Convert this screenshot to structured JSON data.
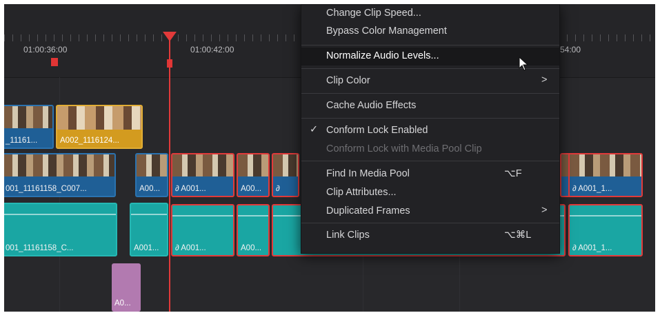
{
  "timeline": {
    "timecodes": [
      "01:00:36:00",
      "01:00:42:00",
      "54:00"
    ],
    "v2_clips": [
      "_11161...",
      "A002_1116124..."
    ],
    "v1_clips": [
      "001_11161158_C007...",
      "A00...",
      "A001...",
      "A00...",
      "A001_1..."
    ],
    "a1_clips": [
      "001_11161158_C...",
      "A001...",
      "A001...",
      "A00...",
      "A001_1...",
      "A0..."
    ],
    "link_icon": "link-icon"
  },
  "menu": {
    "items": [
      {
        "label": "Change Clip Speed..."
      },
      {
        "label": "Bypass Color Management"
      },
      {
        "label": "Normalize Audio Levels...",
        "highlighted": true
      },
      {
        "label": "Clip Color",
        "submenu": true
      },
      {
        "label": "Cache Audio Effects"
      },
      {
        "label": "Conform Lock Enabled",
        "checked": true
      },
      {
        "label": "Conform Lock with Media Pool Clip",
        "disabled": true
      },
      {
        "label": "Find In Media Pool",
        "shortcut": "⌥F"
      },
      {
        "label": "Clip Attributes..."
      },
      {
        "label": "Duplicated Frames",
        "submenu": true
      },
      {
        "label": "Link Clips",
        "shortcut": "⌥⌘L"
      }
    ],
    "check_glyph": "✓",
    "arrow_glyph": ">"
  },
  "colors": {
    "playhead": "#e23a3a",
    "video_clip": "#1f5f96",
    "audio_clip": "#1aa6a3",
    "selected_border": "#e23a3a",
    "menu_bg": "#222225"
  }
}
